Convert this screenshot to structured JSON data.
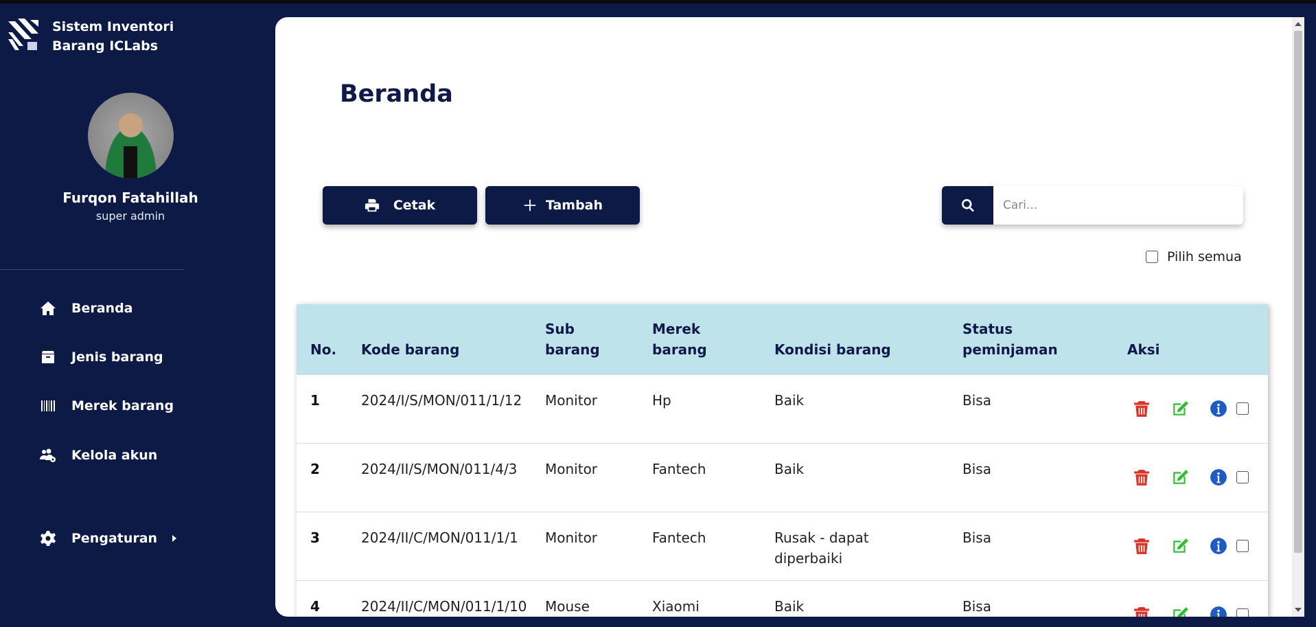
{
  "app": {
    "brand_line1": "Sistem Inventori",
    "brand_line2": "Barang ICLabs",
    "logo_icon": "stripes-logo-icon"
  },
  "user": {
    "name": "Furqon Fatahillah",
    "role": "super admin"
  },
  "sidebar": {
    "items": [
      {
        "label": "Beranda",
        "icon": "home-icon"
      },
      {
        "label": "Jenis barang",
        "icon": "box-icon"
      },
      {
        "label": "Merek barang",
        "icon": "barcode-icon"
      },
      {
        "label": "Kelola akun",
        "icon": "users-gear-icon"
      },
      {
        "label": "Pengaturan",
        "icon": "gear-icon"
      }
    ]
  },
  "page": {
    "title": "Beranda"
  },
  "toolbar": {
    "print_label": "Cetak",
    "add_label": "Tambah",
    "search_placeholder": "Cari...",
    "select_all_label": "Pilih semua"
  },
  "table": {
    "headers": {
      "no": "No.",
      "kode": "Kode barang",
      "sub_1": "Sub",
      "sub_2": "barang",
      "merek_1": "Merek",
      "merek_2": "barang",
      "kondisi": "Kondisi barang",
      "status_1": "Status",
      "status_2": "peminjaman",
      "aksi": "Aksi"
    },
    "rows": [
      {
        "no": "1",
        "kode": "2024/I/S/MON/011/1/12",
        "sub": "Monitor",
        "merek": "Hp",
        "kondisi_1": "Baik",
        "kondisi_2": "",
        "status": "Bisa"
      },
      {
        "no": "2",
        "kode": "2024/II/S/MON/011/4/3",
        "sub": "Monitor",
        "merek": "Fantech",
        "kondisi_1": "Baik",
        "kondisi_2": "",
        "status": "Bisa"
      },
      {
        "no": "3",
        "kode": "2024/II/C/MON/011/1/1",
        "sub": "Monitor",
        "merek": "Fantech",
        "kondisi_1": "Rusak - dapat",
        "kondisi_2": "diperbaiki",
        "status": "Bisa"
      },
      {
        "no": "4",
        "kode": "2024/II/C/MON/011/1/10",
        "sub": "Mouse",
        "merek": "Xiaomi",
        "kondisi_1": "Baik",
        "kondisi_2": "",
        "status": "Bisa"
      }
    ]
  },
  "colors": {
    "sidebar_bg": "#0d1a45",
    "header_bg": "#bee3ea",
    "delete": "#d93226",
    "edit": "#2fbf2f",
    "info": "#1f5bc4"
  }
}
